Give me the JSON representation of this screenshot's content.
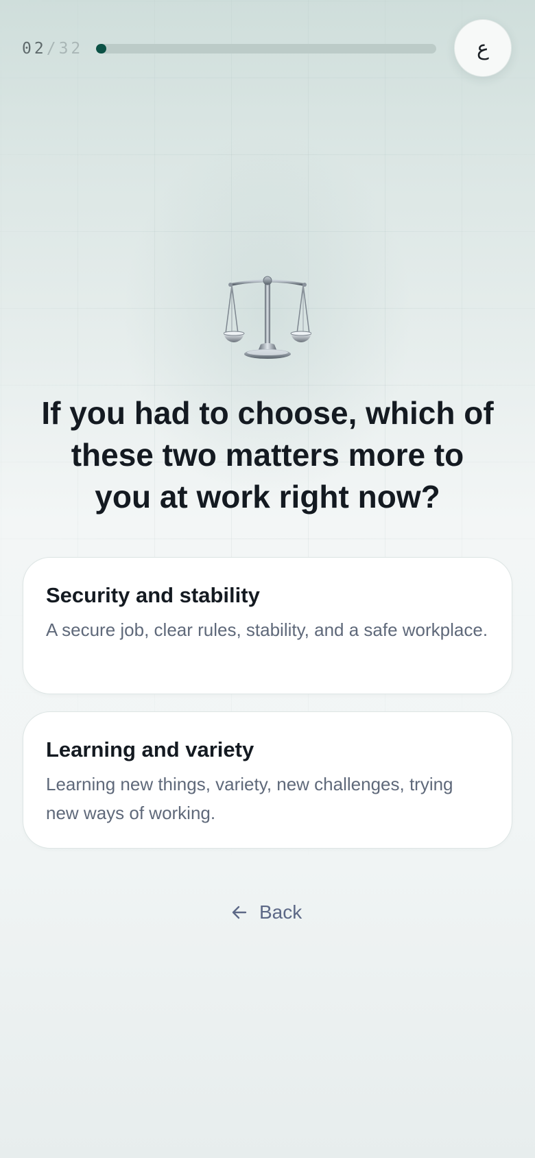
{
  "progress": {
    "current": "02",
    "separator": "/",
    "total": "32",
    "fraction": 0.03
  },
  "language_button": {
    "label": "ع"
  },
  "icon": "balance-scale-icon",
  "question": {
    "text": "If you had to choose, which of these two matters more to you at work right now?"
  },
  "options": [
    {
      "title": "Security and stability",
      "description": "A secure job, clear rules, stability, and a safe workplace."
    },
    {
      "title": "Learning and variety",
      "description": "Learning new things, variety, new challenges, trying new ways of working."
    }
  ],
  "back": {
    "label": "Back"
  },
  "colors": {
    "accent": "#0c5246",
    "track": "#bccbc8",
    "title_text": "#141a21",
    "muted_text": "#5f697a",
    "back_text": "#5c6886"
  }
}
